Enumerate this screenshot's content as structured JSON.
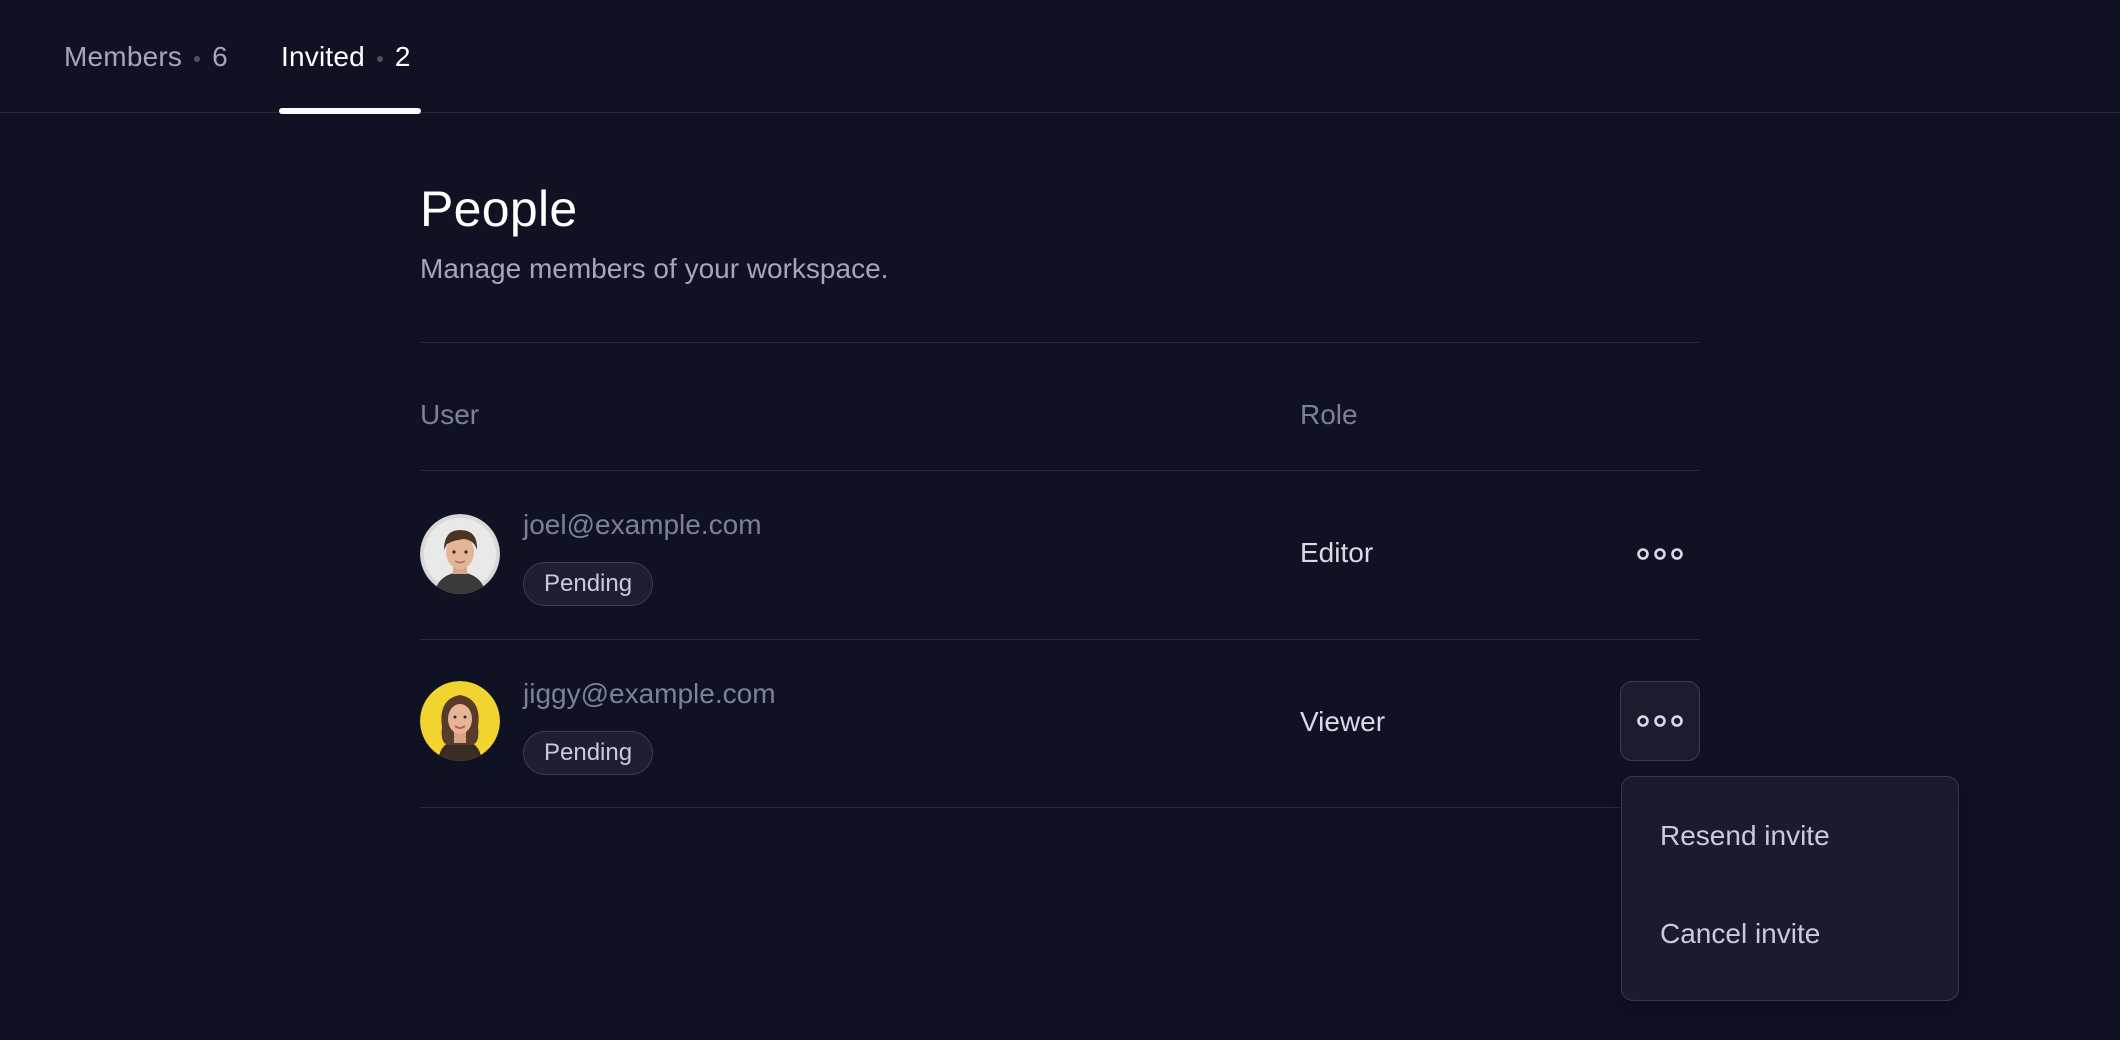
{
  "tabs": [
    {
      "label": "Members",
      "count": "6",
      "active": false
    },
    {
      "label": "Invited",
      "count": "2",
      "active": true
    }
  ],
  "page": {
    "title": "People",
    "subtitle": "Manage members of your workspace."
  },
  "table": {
    "columns": {
      "user": "User",
      "role": "Role"
    },
    "rows": [
      {
        "email": "joel@example.com",
        "status": "Pending",
        "role": "Editor",
        "avatar_icon": "avatar-man-icon"
      },
      {
        "email": "jiggy@example.com",
        "status": "Pending",
        "role": "Viewer",
        "avatar_icon": "avatar-woman-icon"
      }
    ]
  },
  "menu": {
    "items": [
      "Resend invite",
      "Cancel invite"
    ]
  },
  "colors": {
    "background": "#0f1222",
    "active_tab": "#ffffff",
    "muted_text": "#7c8196",
    "avatar_yellow": "#f2d431"
  }
}
